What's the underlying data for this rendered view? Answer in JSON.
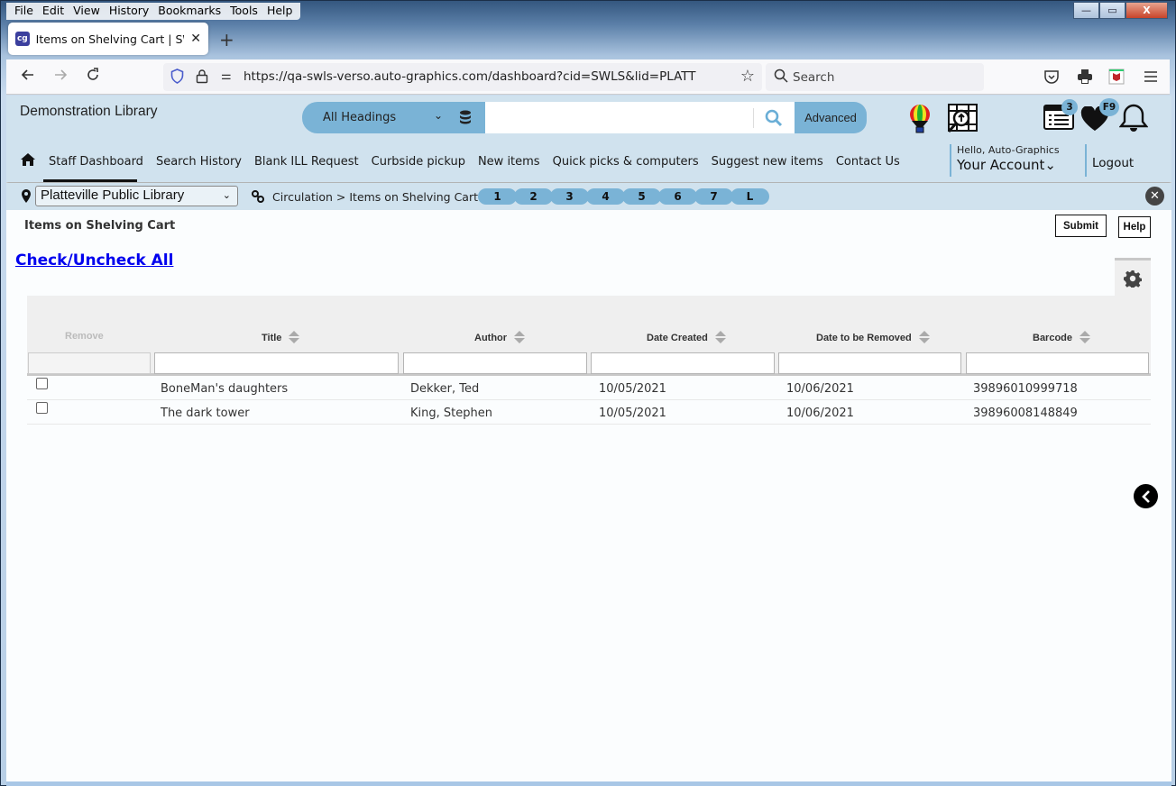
{
  "browser": {
    "menu": [
      "File",
      "Edit",
      "View",
      "History",
      "Bookmarks",
      "Tools",
      "Help"
    ],
    "window_controls": {
      "minimize": "—",
      "maximize": "▭",
      "close": "X"
    },
    "tab": {
      "title": "Items on Shelving Cart | SWLS | I",
      "favicon": "cg",
      "close": "✕"
    },
    "new_tab": "+",
    "url": "https://qa-swls-verso.auto-graphics.com/dashboard?cid=SWLS&lid=PLATT",
    "search_placeholder": "Search",
    "icons": [
      "back-arrow-icon",
      "forward-arrow-icon",
      "reload-icon",
      "shield-icon",
      "lock-icon",
      "permissions-icon",
      "bookmark-star-icon",
      "pocket-icon",
      "print-icon",
      "mcafee-icon",
      "hamburger-menu-icon"
    ]
  },
  "app": {
    "library_name": "Demonstration Library",
    "search": {
      "scope": "All Headings",
      "query": "",
      "advanced_label": "Advanced"
    },
    "badges": {
      "list": "3",
      "favorites": "F9"
    },
    "nav": [
      "Staff Dashboard",
      "Search History",
      "Blank ILL Request",
      "Curbside pickup",
      "New items",
      "Quick picks & computers",
      "Suggest new items",
      "Contact Us"
    ],
    "active_nav": "Staff Dashboard",
    "account": {
      "greeting": "Hello, Auto-Graphics",
      "label": "Your Account",
      "chevron": "⌄"
    },
    "logout": "Logout"
  },
  "subbar": {
    "location": "Platteville Public Library",
    "breadcrumb": "Circulation > Items on Shelving Cart",
    "quick_tabs": [
      "1",
      "2",
      "3",
      "4",
      "5",
      "6",
      "7",
      "L"
    ]
  },
  "content": {
    "title": "Items on Shelving Cart",
    "submit_label": "Submit",
    "help_label": "Help",
    "check_all_label": "Check/Uncheck All",
    "table": {
      "columns": [
        "Remove",
        "Title",
        "Author",
        "Date Created",
        "Date to be Removed",
        "Barcode"
      ],
      "rows": [
        {
          "checked": false,
          "title": "BoneMan's daughters",
          "author": "Dekker, Ted",
          "date_created": "10/05/2021",
          "date_removed": "10/06/2021",
          "barcode": "39896010999718"
        },
        {
          "checked": false,
          "title": "The dark tower",
          "author": "King, Stephen",
          "date_created": "10/05/2021",
          "date_removed": "10/06/2021",
          "barcode": "39896008148849"
        }
      ]
    }
  }
}
